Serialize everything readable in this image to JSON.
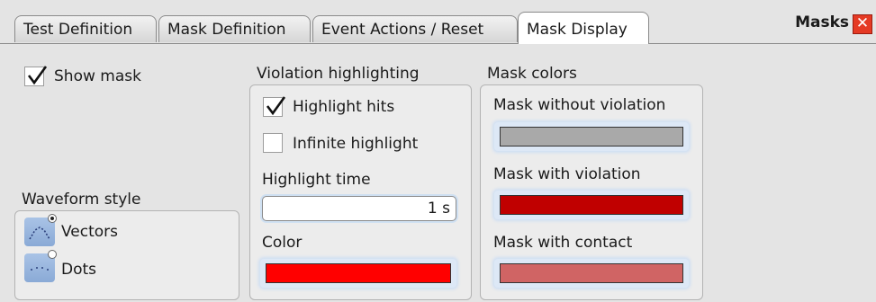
{
  "tabs": [
    {
      "label": "Test Definition"
    },
    {
      "label": "Mask Definition"
    },
    {
      "label": "Event Actions / Reset"
    },
    {
      "label": "Mask Display"
    }
  ],
  "dialog": {
    "title": "Masks",
    "close_symbol": "✕"
  },
  "show_mask": {
    "label": "Show mask",
    "checked": true
  },
  "waveform_style": {
    "title": "Waveform style",
    "options": [
      {
        "label": "Vectors",
        "selected": true,
        "icon": "vectors-icon"
      },
      {
        "label": "Dots",
        "selected": false,
        "icon": "dots-icon"
      }
    ]
  },
  "violation": {
    "title": "Violation highlighting",
    "highlight_hits": {
      "label": "Highlight hits",
      "checked": true
    },
    "infinite_highlight": {
      "label": "Infinite highlight",
      "checked": false
    },
    "highlight_time": {
      "label": "Highlight time",
      "value": "1 s"
    },
    "color": {
      "label": "Color",
      "value": "#ff0000"
    }
  },
  "mask_colors": {
    "title": "Mask colors",
    "without_violation": {
      "label": "Mask without violation",
      "value": "#a9a9a9"
    },
    "with_violation": {
      "label": "Mask with violation",
      "value": "#c00000"
    },
    "with_contact": {
      "label": "Mask with contact",
      "value": "#d06464"
    }
  }
}
